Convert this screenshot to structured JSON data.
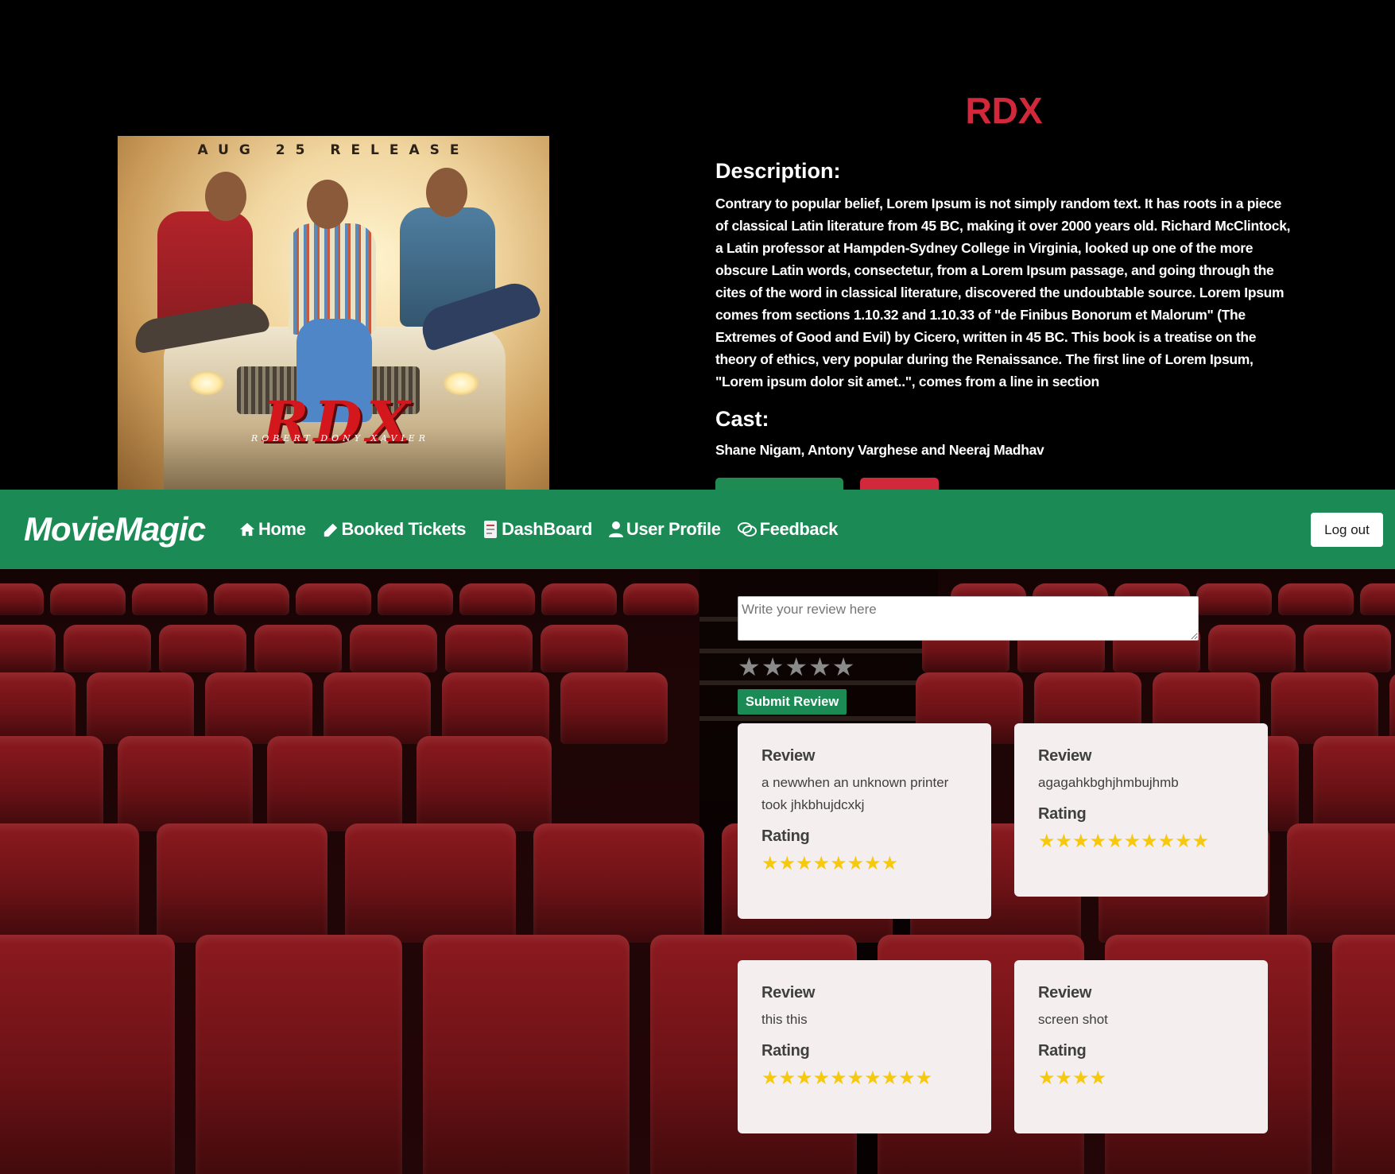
{
  "poster": {
    "release_text": "AUG 25 RELEASE",
    "logo_text": "RDX",
    "names_text": "ROBERT DONY XAVIER"
  },
  "movie": {
    "title": "RDX",
    "description_heading": "Description:",
    "description": "Contrary to popular belief, Lorem Ipsum is not simply random text. It has roots in a piece of classical Latin literature from 45 BC, making it over 2000 years old. Richard McClintock, a Latin professor at Hampden-Sydney College in Virginia, looked up one of the more obscure Latin words, consectetur, from a Lorem Ipsum passage, and going through the cites of the word in classical literature, discovered the undoubtable source. Lorem Ipsum comes from sections 1.10.32 and 1.10.33 of \"de Finibus Bonorum et Malorum\" (The Extremes of Good and Evil) by Cicero, written in 45 BC. This book is a treatise on the theory of ethics, very popular during the Renaissance. The first line of Lorem Ipsum, \"Lorem ipsum dolor sit amet..\", comes from a line in section",
    "cast_heading": "Cast:",
    "cast": "Shane Nigam, Antony Varghese and Neeraj Madhav"
  },
  "navbar": {
    "brand": "MovieMagic",
    "links": [
      {
        "label": "Home",
        "icon": "home-icon"
      },
      {
        "label": "Booked Tickets",
        "icon": "ticket-icon"
      },
      {
        "label": "DashBoard",
        "icon": "document-icon"
      },
      {
        "label": "User Profile",
        "icon": "user-icon"
      },
      {
        "label": "Feedback",
        "icon": "chat-icon"
      }
    ],
    "logout_label": "Log out",
    "background_color": "#1c8a55"
  },
  "review_form": {
    "placeholder": "Write your review here",
    "star_count": 5,
    "submit_label": "Submit Review"
  },
  "reviews": [
    {
      "review_label": "Review",
      "text": "a newwhen an unknown printer took jhkbhujdcxkj",
      "rating_label": "Rating",
      "stars": "★★★★★★★★"
    },
    {
      "review_label": "Review",
      "text": "agagahkbghjhmbujhmb",
      "rating_label": "Rating",
      "stars": "★★★★★★★★★★"
    },
    {
      "review_label": "Review",
      "text": "this this",
      "rating_label": "Rating",
      "stars": "★★★★★★★★★★"
    },
    {
      "review_label": "Review",
      "text": "screen shot",
      "rating_label": "Rating",
      "stars": "★★★★"
    }
  ],
  "colors": {
    "title_red": "#d2283b",
    "accent_green": "#1c8a55",
    "star_gold": "#f6c90e"
  }
}
